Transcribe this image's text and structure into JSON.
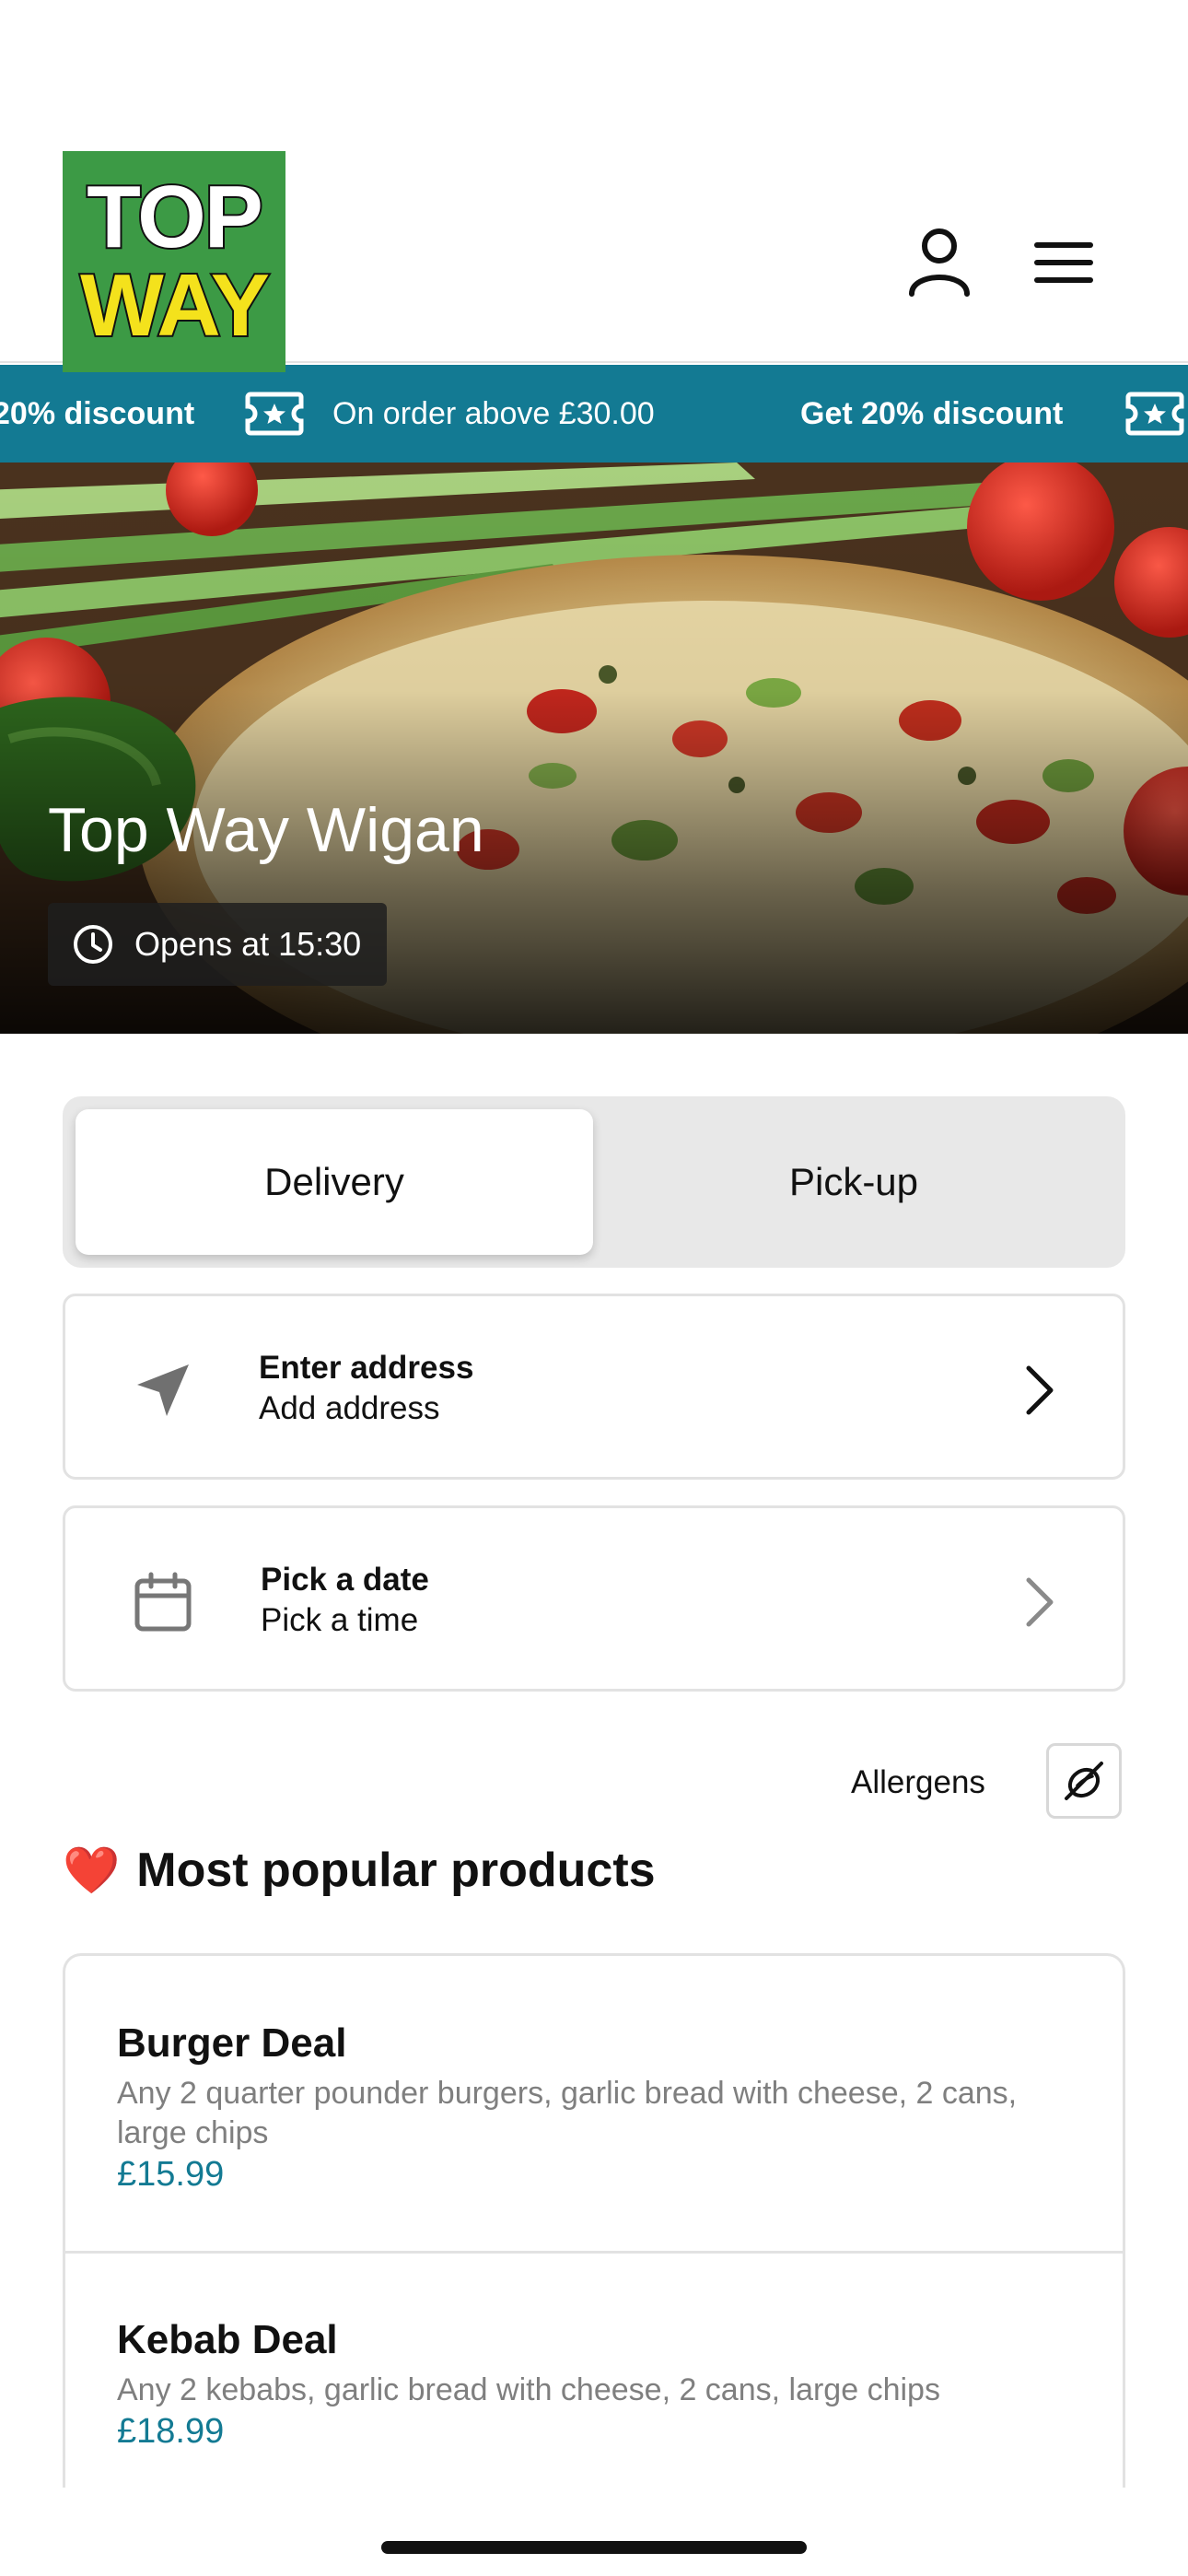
{
  "header": {
    "logo": {
      "line1": "TOP",
      "line2": "WAY"
    },
    "account_icon": "person-icon",
    "menu_icon": "hamburger-menu-icon"
  },
  "promo_ticker": {
    "items": [
      {
        "text": "20% discount",
        "bold": true
      },
      {
        "text": "On order above £30.00",
        "bold": false
      },
      {
        "text": "Get 20% discount",
        "bold": true
      }
    ],
    "icon": "coupon-star-icon",
    "background": "#137a93"
  },
  "hero": {
    "title": "Top Way Wigan",
    "opening": "Opens at 15:30",
    "clock_icon": "clock-icon"
  },
  "order_mode": {
    "options": [
      "Delivery",
      "Pick-up"
    ],
    "selected": "Delivery"
  },
  "address_card": {
    "title": "Enter address",
    "subtitle": "Add address",
    "icon": "location-arrow-icon"
  },
  "schedule_card": {
    "title": "Pick a date",
    "subtitle": "Pick a time",
    "icon": "calendar-icon"
  },
  "allergens": {
    "label": "Allergens",
    "icon": "allergen-filter-icon"
  },
  "popular": {
    "emoji": "❤️",
    "title": "Most popular products",
    "products": [
      {
        "name": "Burger Deal",
        "description": "Any 2 quarter pounder burgers, garlic bread with cheese, 2 cans, large chips",
        "price": "£15.99"
      },
      {
        "name": "Kebab Deal",
        "description": "Any 2 kebabs, garlic bread with cheese, 2 cans, large chips",
        "price": "£18.99"
      }
    ]
  },
  "colors": {
    "accent": "#137a93",
    "logo_green": "#3c9a45",
    "logo_yellow": "#f4e21c"
  }
}
